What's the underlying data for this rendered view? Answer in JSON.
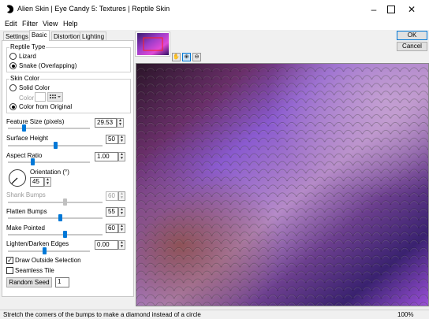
{
  "window": {
    "title": "Alien Skin | Eye Candy 5: Textures | Reptile Skin",
    "minimize_icon": "minimize-icon",
    "maximize_icon": "maximize-icon",
    "close_icon": "close-icon"
  },
  "menu": [
    "Edit",
    "Filter",
    "View",
    "Help"
  ],
  "tabs": [
    "Settings",
    "Basic",
    "Distortion",
    "Lighting"
  ],
  "active_tab": "Basic",
  "buttons": {
    "ok": "OK",
    "cancel": "Cancel"
  },
  "reptile_type": {
    "legend": "Reptile Type",
    "options": [
      "Lizard",
      "Snake (Overlapping)"
    ],
    "selected": "Snake (Overlapping)"
  },
  "skin_color": {
    "legend": "Skin Color",
    "solid_color_label": "Solid Color",
    "color_label": "Color",
    "from_original_label": "Color from Original",
    "selected": "Color from Original"
  },
  "controls": {
    "feature_size": {
      "label": "Feature Size (pixels)",
      "value": "29.53",
      "level": 0.2
    },
    "surface_height": {
      "label": "Surface Height",
      "value": "50",
      "level": 0.5
    },
    "aspect_ratio": {
      "label": "Aspect Ratio",
      "value": "1.00",
      "level": 0.3
    },
    "orientation": {
      "label": "Orientation (°)",
      "value": "45"
    },
    "shank_bumps": {
      "label": "Shank Bumps",
      "value": "60",
      "level": 0.6,
      "disabled": true
    },
    "flatten_bumps": {
      "label": "Flatten Bumps",
      "value": "55",
      "level": 0.55
    },
    "make_pointed": {
      "label": "Make Pointed",
      "value": "60",
      "level": 0.6
    },
    "lighten_darken": {
      "label": "Lighten/Darken Edges",
      "value": "0.00",
      "level": 0.45
    }
  },
  "checkboxes": {
    "draw_outside": {
      "label": "Draw Outside Selection",
      "checked": true
    },
    "seamless_tile": {
      "label": "Seamless Tile",
      "checked": false
    }
  },
  "random_seed": {
    "label": "Random Seed",
    "value": "1"
  },
  "preview_tools": [
    "hand-icon",
    "zoom-in-icon",
    "zoom-out-icon"
  ],
  "status": {
    "message": "Stretch the corners of the bumps to make a diamond instead of a circle",
    "zoom": "100%"
  },
  "colors": {
    "accent": "#0078d7",
    "ok_border": "#0078d7"
  }
}
